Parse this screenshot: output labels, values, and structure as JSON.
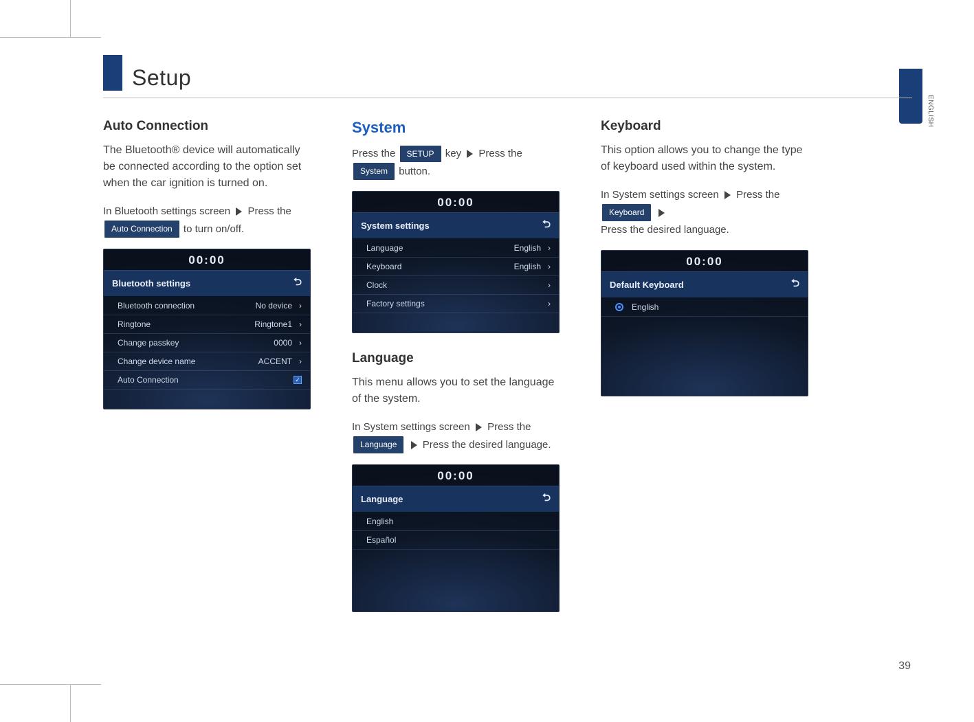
{
  "meta": {
    "page_number": "39",
    "lang_tab": "ENGLISH",
    "section_title": "Setup"
  },
  "col1": {
    "heading": "Auto Connection",
    "p1": "The Bluetooth® device will automatically be connected according to the option set when the car ignition is turned on.",
    "instr_pre": "In Bluetooth settings screen",
    "instr_mid": "Press the",
    "btn": "Auto Connection",
    "instr_post": "to turn on/off."
  },
  "panel_bt": {
    "clock": "00:00",
    "title": "Bluetooth settings",
    "rows": [
      {
        "label": "Bluetooth connection",
        "value": "No device",
        "chevron": true
      },
      {
        "label": "Ringtone",
        "value": "Ringtone1",
        "chevron": true
      },
      {
        "label": "Change passkey",
        "value": "0000",
        "chevron": true
      },
      {
        "label": "Change device name",
        "value": "ACCENT",
        "chevron": true
      },
      {
        "label": "Auto Connection",
        "checkbox": true
      }
    ]
  },
  "col2": {
    "heading": "System",
    "instr_a": "Press the",
    "btn_a": "SETUP",
    "instr_b": "key",
    "instr_c": "Press the",
    "btn_b": "System",
    "instr_d": "button.",
    "lang_heading": "Language",
    "lang_p": "This menu allows you to set the language of the system.",
    "lang_instr_a": "In System settings screen",
    "lang_instr_b": "Press the",
    "lang_btn": "Language",
    "lang_instr_c": "Press the desired language."
  },
  "panel_sys": {
    "clock": "00:00",
    "title": "System settings",
    "rows": [
      {
        "label": "Language",
        "value": "English",
        "chevron": true
      },
      {
        "label": "Keyboard",
        "value": "English",
        "chevron": true
      },
      {
        "label": "Clock",
        "chevron": true
      },
      {
        "label": "Factory settings",
        "chevron": true
      }
    ]
  },
  "panel_lang": {
    "clock": "00:00",
    "title": "Language",
    "rows": [
      {
        "label": "English"
      },
      {
        "label": "Español"
      }
    ]
  },
  "col3": {
    "heading": "Keyboard",
    "p1": "This option allows you to change the type of keyboard used within the system.",
    "instr_a": "In System settings screen",
    "instr_b": "Press the",
    "btn": "Keyboard",
    "instr_c": "Press the desired language."
  },
  "panel_kbd": {
    "clock": "00:00",
    "title": "Default Keyboard",
    "rows": [
      {
        "label": "English",
        "radio": true
      }
    ]
  }
}
